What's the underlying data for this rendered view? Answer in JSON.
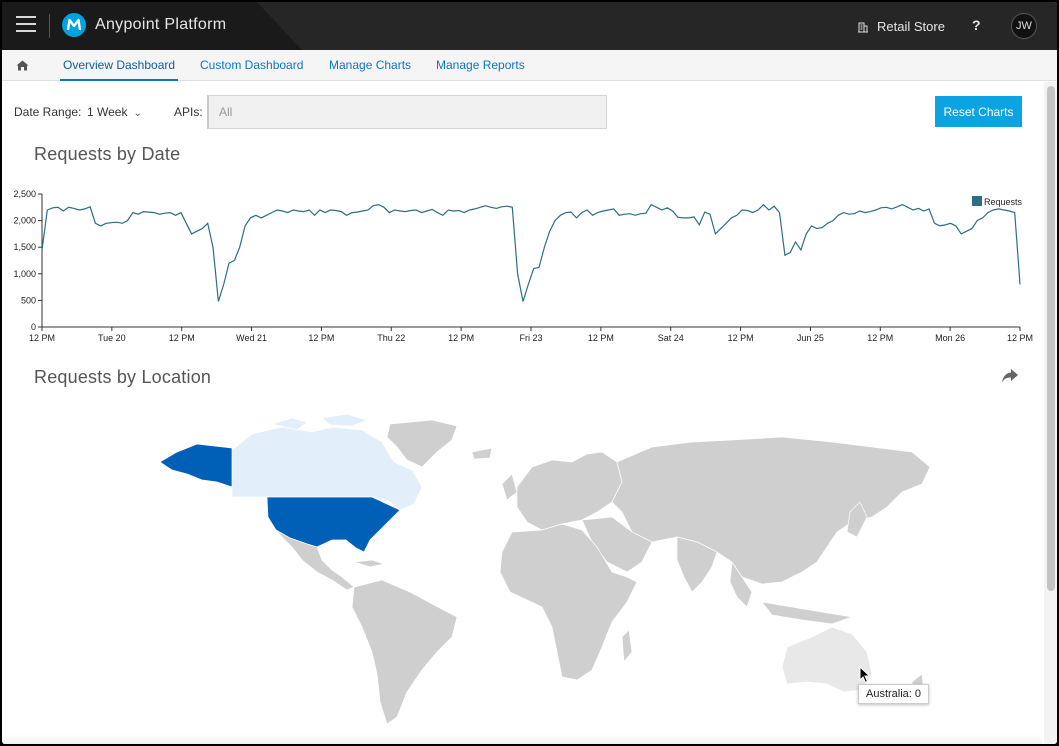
{
  "header": {
    "app_title": "Anypoint Platform",
    "org_name": "Retail Store",
    "help_label": "?",
    "user_initials": "JW",
    "icons": [
      "hamburger-menu-icon",
      "mulesoft-logo-icon",
      "building-icon"
    ]
  },
  "tabs": [
    {
      "label": "Overview Dashboard",
      "active": true
    },
    {
      "label": "Custom Dashboard",
      "active": false
    },
    {
      "label": "Manage Charts",
      "active": false
    },
    {
      "label": "Manage Reports",
      "active": false
    }
  ],
  "filters": {
    "date_range_label": "Date Range:",
    "date_range_value": "1 Week",
    "apis_label": "APIs:",
    "apis_placeholder": "All",
    "reset_label": "Reset Charts"
  },
  "requests_by_date": {
    "title": "Requests by Date"
  },
  "chart_data": {
    "type": "line",
    "title": "Requests by Date",
    "xlabel": "",
    "ylabel": "",
    "ylim": [
      0,
      2500
    ],
    "y_ticks": [
      "0",
      "500",
      "1,000",
      "1,500",
      "2,000",
      "2,500"
    ],
    "x_tick_labels": [
      "12 PM",
      "Tue 20",
      "12 PM",
      "Wed 21",
      "12 PM",
      "Thu 22",
      "12 PM",
      "Fri 23",
      "12 PM",
      "Sat 24",
      "12 PM",
      "Jun 25",
      "12 PM",
      "Mon 26",
      "12 PM"
    ],
    "legend_position": "top-right",
    "series": [
      {
        "name": "Requests",
        "color": "#2b6e86",
        "values": [
          1450,
          2200,
          2240,
          2250,
          2180,
          2250,
          2230,
          2200,
          2220,
          2260,
          1950,
          1900,
          1950,
          1960,
          1970,
          1950,
          2000,
          2150,
          2120,
          2170,
          2160,
          2150,
          2120,
          2140,
          2150,
          2100,
          2150,
          1950,
          1750,
          1800,
          1850,
          1950,
          1500,
          480,
          800,
          1200,
          1250,
          1500,
          1900,
          2050,
          2100,
          2050,
          2100,
          2150,
          2200,
          2180,
          2150,
          2200,
          2180,
          2170,
          2200,
          2100,
          2200,
          2150,
          2200,
          2190,
          2170,
          2100,
          2150,
          2160,
          2180,
          2200,
          2280,
          2300,
          2250,
          2150,
          2200,
          2180,
          2170,
          2190,
          2200,
          2150,
          2180,
          2210,
          2150,
          2100,
          2200,
          2180,
          2190,
          2150,
          2200,
          2220,
          2250,
          2280,
          2250,
          2230,
          2260,
          2270,
          2250,
          1000,
          480,
          800,
          1100,
          1120,
          1500,
          1800,
          2000,
          2100,
          2150,
          2160,
          2050,
          2150,
          2200,
          2100,
          2150,
          2180,
          2200,
          2220,
          2100,
          2120,
          2130,
          2100,
          2130,
          2140,
          2300,
          2250,
          2200,
          2240,
          2180,
          2060,
          2050,
          2050,
          2070,
          1920,
          2160,
          2120,
          1750,
          1850,
          1950,
          2050,
          2100,
          2200,
          2190,
          2150,
          2200,
          2300,
          2200,
          2270,
          2150,
          1350,
          1400,
          1600,
          1450,
          1750,
          1900,
          1850,
          1870,
          1950,
          2000,
          2100,
          2150,
          2120,
          2130,
          2180,
          2150,
          2170,
          2200,
          2240,
          2250,
          2220,
          2260,
          2300,
          2250,
          2200,
          2230,
          2180,
          2220,
          1950,
          1900,
          1920,
          1950,
          1900,
          1750,
          1800,
          1850,
          2000,
          2050,
          2150,
          2200,
          2220,
          2200,
          2180,
          2150,
          800
        ]
      }
    ]
  },
  "requests_by_location": {
    "title": "Requests by Location",
    "tooltip": "Australia: 0",
    "icons": [
      "share-icon",
      "mouse-cursor-icon"
    ]
  },
  "colors": {
    "accent": "#0ca3e3",
    "tab_link": "#0a76c6",
    "map_high": "#0060b8",
    "map_low": "#e2effb",
    "map_none": "#cfcfcf"
  }
}
